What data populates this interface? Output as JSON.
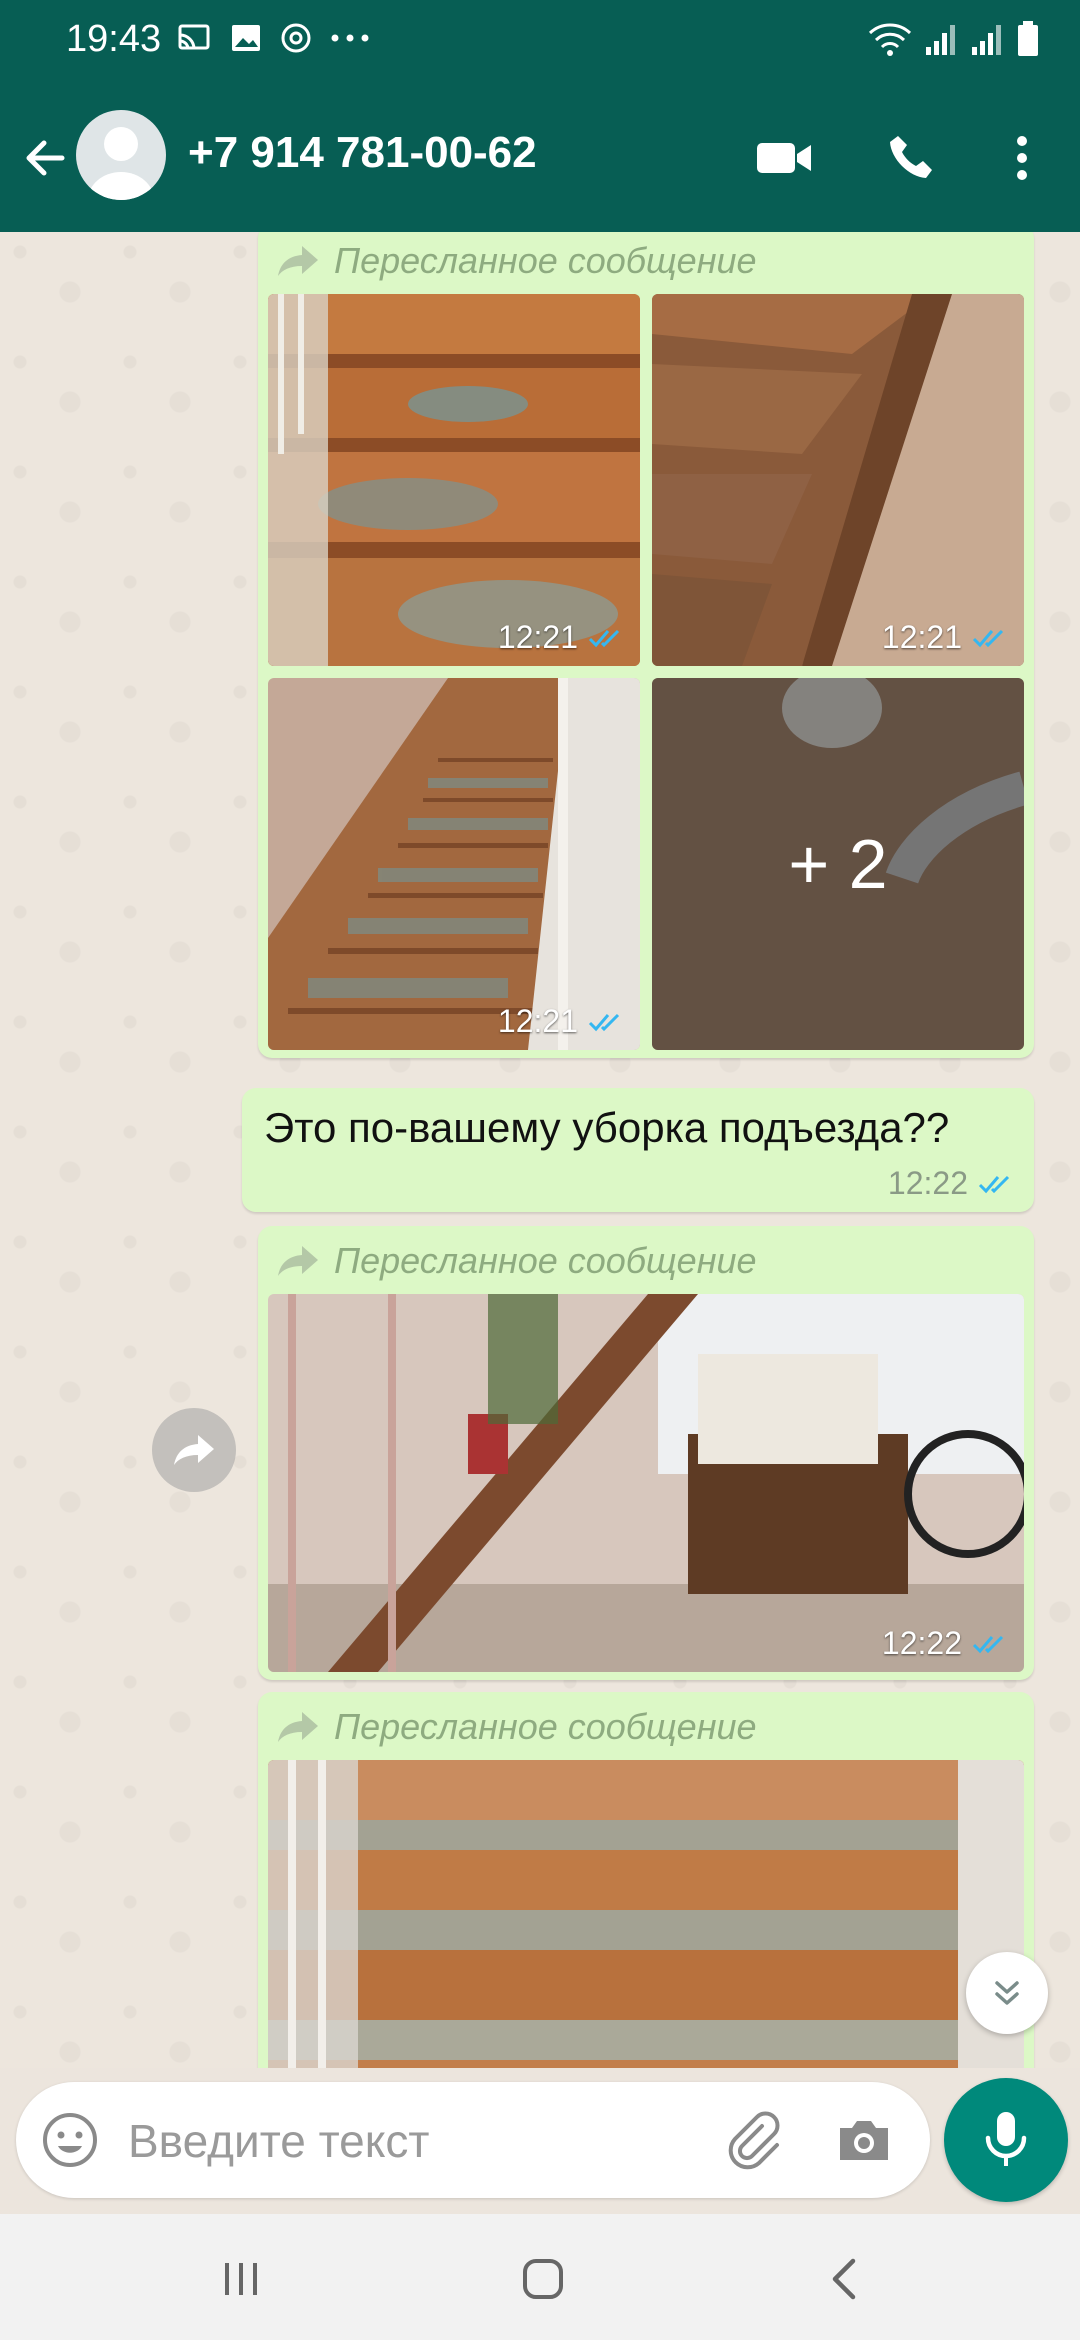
{
  "status_bar": {
    "time": "19:43",
    "icons": [
      "cast-icon",
      "image-icon",
      "at-icon",
      "more-dots-icon",
      "wifi-icon",
      "signal-icon",
      "signal-icon",
      "battery-icon"
    ]
  },
  "header": {
    "contact_name": "+7 914 781-00-62",
    "icons": [
      "back-arrow-icon",
      "avatar-icon",
      "video-call-icon",
      "phone-icon",
      "more-vert-icon"
    ]
  },
  "messages": [
    {
      "type": "forwarded-album",
      "forwarded_label": "Пересланное сообщение",
      "photos": [
        {
          "time": "12:21",
          "status": "read"
        },
        {
          "time": "12:21",
          "status": "read"
        },
        {
          "time": "12:21",
          "status": "read"
        },
        {
          "overlay": "+ 2"
        }
      ]
    },
    {
      "type": "text",
      "text": "Это по-вашему уборка подъезда??",
      "time": "12:22",
      "status": "read"
    },
    {
      "type": "forwarded-photo",
      "forwarded_label": "Пересланное сообщение",
      "time": "12:22",
      "status": "read"
    },
    {
      "type": "forwarded-photo",
      "forwarded_label": "Пересланное сообщение"
    }
  ],
  "input": {
    "placeholder": "Введите текст",
    "icons": [
      "emoji-icon",
      "attach-icon",
      "camera-icon",
      "mic-icon"
    ]
  },
  "colors": {
    "header": "#075e54",
    "bubble_out": "#dcf8c6",
    "read_ticks": "#34b7f1",
    "mic_button": "#00897b"
  },
  "nav_bar": {
    "icons": [
      "recents-icon",
      "home-icon",
      "back-icon"
    ]
  }
}
